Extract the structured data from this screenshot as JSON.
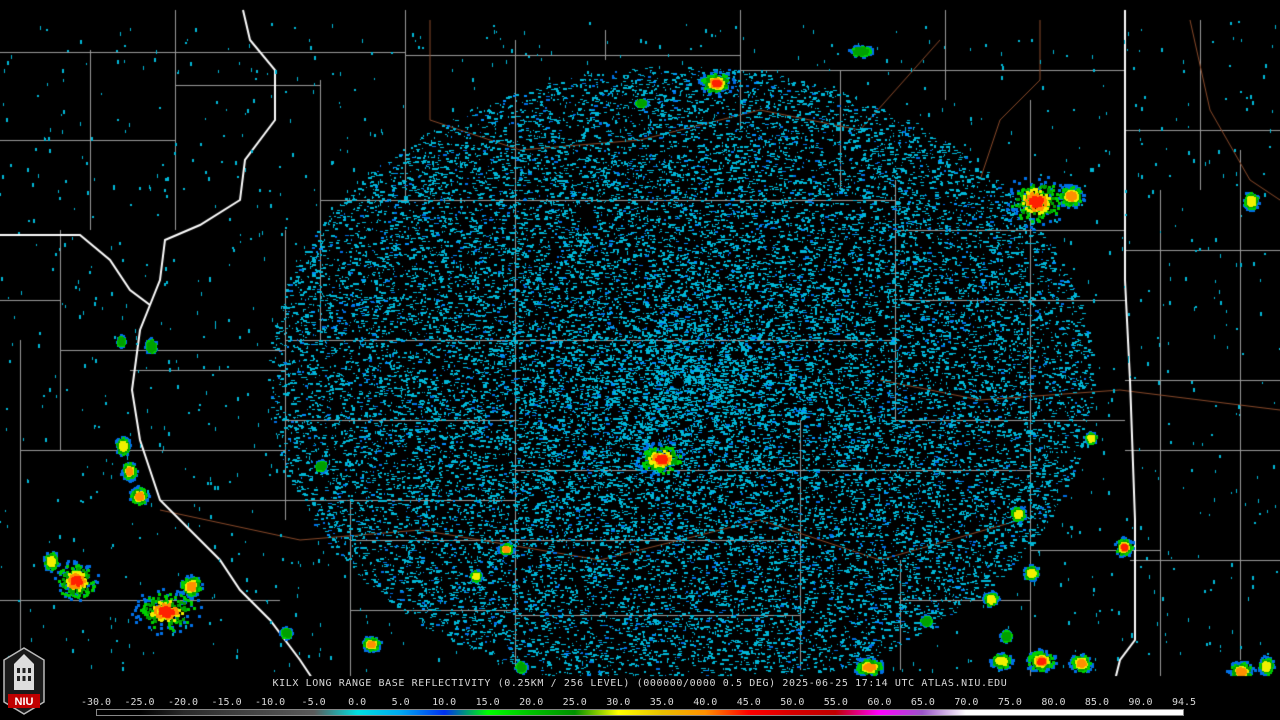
{
  "caption": "KILX LONG RANGE BASE REFLECTIVITY (0.25KM / 256 LEVEL) (000000/0000 0.5 DEG) 2025-06-25 17:14 UTC  ATLAS.NIU.EDU",
  "logo_text": "NIU",
  "scale": {
    "labels": [
      "-30.0",
      "-25.0",
      "-20.0",
      "-15.0",
      "-10.0",
      "-5.0",
      "0.0",
      "5.0",
      "10.0",
      "15.0",
      "20.0",
      "25.0",
      "30.0",
      "35.0",
      "40.0",
      "45.0",
      "50.0",
      "55.0",
      "60.0",
      "65.0",
      "70.0",
      "75.0",
      "80.0",
      "85.0",
      "90.0",
      "94.5"
    ],
    "gradient_stops": [
      "#000000",
      "#000000",
      "#2a2a2a",
      "#3c3c3c",
      "#4a4a4a",
      "#5a5a5a",
      "#00e0e0",
      "#00a8f0",
      "#0030f0",
      "#00ff00",
      "#00c000",
      "#009000",
      "#ffff00",
      "#e7c000",
      "#ff9000",
      "#ff0000",
      "#d60000",
      "#c00000",
      "#ff00ff",
      "#9955c9",
      "#ffffff",
      "#ffffff",
      "#ffffff",
      "#ffffff",
      "#ffffff",
      "#ffffff"
    ]
  },
  "colors": {
    "state_border": "#ffffff",
    "county_line": "#9a9a9a",
    "road": "#8a4a2a",
    "echo_light": "#00b8d8",
    "echo_medium": "#0070e8",
    "echo_green": "#00d000",
    "echo_yellow": "#f0f000",
    "echo_orange": "#ff9000",
    "echo_red": "#ff2000"
  }
}
